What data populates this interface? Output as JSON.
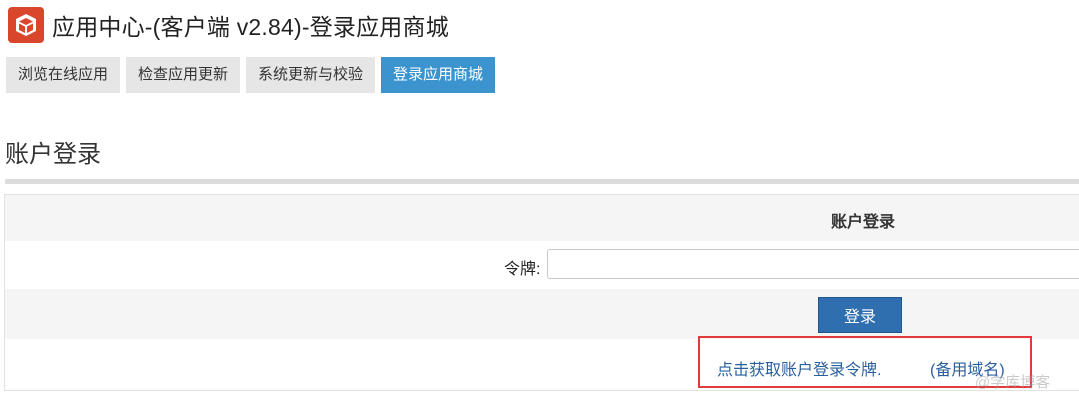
{
  "header": {
    "title": "应用中心-(客户端 v2.84)-登录应用商城",
    "logo_icon": "app-box-icon"
  },
  "tabs": [
    {
      "label": "浏览在线应用",
      "active": false
    },
    {
      "label": "检查应用更新",
      "active": false
    },
    {
      "label": "系统更新与校验",
      "active": false
    },
    {
      "label": "登录应用商城",
      "active": true
    }
  ],
  "section": {
    "title": "账户登录"
  },
  "login": {
    "table_header": "账户登录",
    "token_label": "令牌:",
    "token_value": "",
    "login_button": "登录",
    "get_token_link": "点击获取账户登录令牌.",
    "backup_domain_link": "(备用域名)"
  },
  "watermark": "@学库博客",
  "colors": {
    "accent": "#3c94cf",
    "button": "#2f6fb0",
    "logo": "#d9462b",
    "highlight_box": "#e03a3a",
    "link": "#2a5f9e"
  }
}
